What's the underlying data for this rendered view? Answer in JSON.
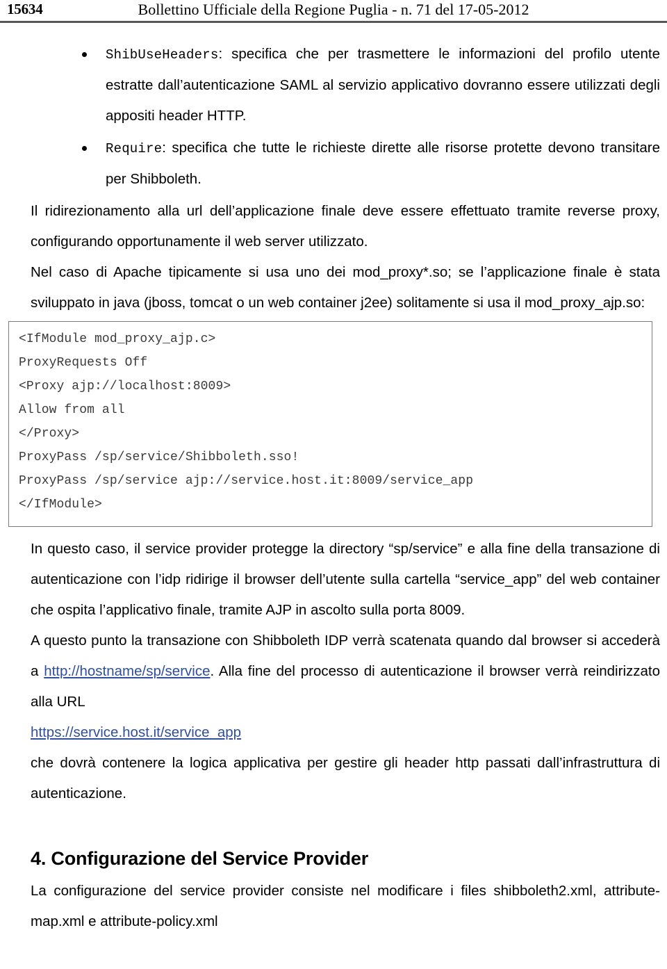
{
  "header": {
    "folio": "15634",
    "running_title": "Bollettino Ufficiale della Regione Puglia - n. 71 del 17-05-2012"
  },
  "bullets": [
    {
      "term": "ShibUseHeaders",
      "text": ": specifica che per trasmettere le informazioni del profilo utente estratte dall’autenticazione SAML al servizio applicativo dovranno essere utilizzati degli appositi header HTTP."
    },
    {
      "term": "Require",
      "text": ": specifica che tutte le richieste dirette alle risorse protette devono transitare per Shibboleth."
    }
  ],
  "paragraphs": {
    "redirect": "Il ridirezionamento alla url dell’applicazione finale deve essere effettuato tramite reverse proxy, configurando opportunamente il web server utilizzato.",
    "apache": "Nel caso di Apache tipicamente si usa uno dei mod_proxy*.so; se l’applicazione finale è stata sviluppato in java (jboss, tomcat o un web container j2ee) solitamente si usa il mod_proxy_ajp.so:",
    "in_questo_caso": "In questo caso, il service provider protegge la directory “sp/service” e alla fine della transazione di autenticazione con l’idp ridirige il browser dell’utente sulla cartella “service_app” del web container che ospita l’applicativo finale, tramite AJP in ascolto sulla porta 8009.",
    "transazione_pre_link": "A questo punto la transazione con Shibboleth IDP verrà scatenata quando dal browser si accederà a ",
    "transazione_post_link": ". Alla fine del processo di autenticazione il browser verrà reindirizzato alla URL",
    "logica": "che dovrà contenere la logica applicativa per gestire gli header http passati dall’infrastruttura di autenticazione.",
    "sp_config": "La configurazione del service provider consiste nel modificare i files shibboleth2.xml, attribute-map.xml e attribute-policy.xml"
  },
  "links": {
    "http_hostname": "http://hostname/sp/service",
    "https_service": "https://service.host.it/service_app",
    "color": "#2f4f9e"
  },
  "code_block": {
    "lines": [
      "<IfModule mod_proxy_ajp.c>",
      "ProxyRequests Off",
      "<Proxy ajp://localhost:8009>",
      "Allow from all",
      "</Proxy>",
      "ProxyPass /sp/service/Shibboleth.sso!",
      "ProxyPass /sp/service ajp://service.host.it:8009/service_app",
      "</IfModule>"
    ]
  },
  "section": {
    "heading": "4. Configurazione del Service Provider"
  }
}
